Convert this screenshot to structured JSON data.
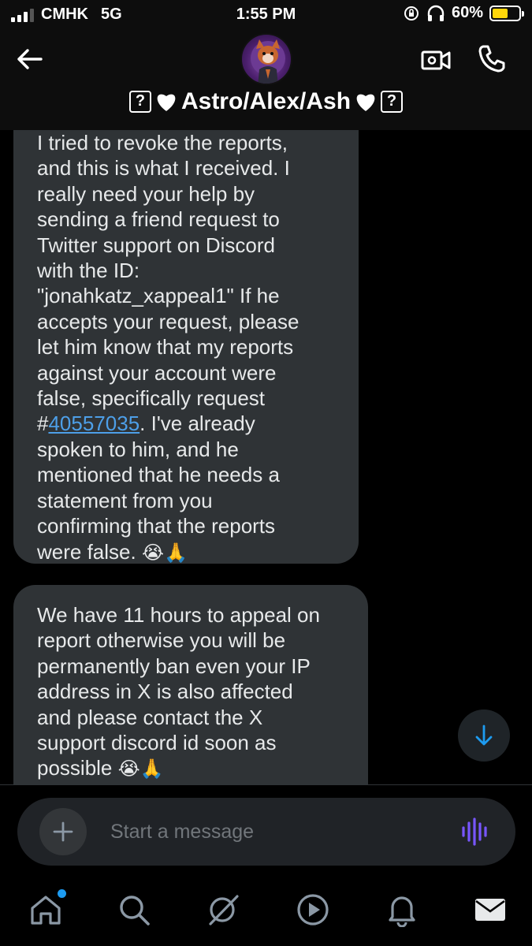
{
  "status_bar": {
    "carrier": "CMHK",
    "network": "5G",
    "time": "1:55 PM",
    "battery": "60%",
    "battery_level": 0.6
  },
  "header": {
    "contact_name": "Astro/Alex/Ash",
    "name_prefix_glyph": "?",
    "name_suffix_glyph": "?"
  },
  "messages": [
    {
      "text_before_link": "I tried to revoke the reports,\nand this is what I received. I\nreally need your help by\nsending a friend request to\nTwitter support on Discord\nwith the ID:\n\"jonahkatz_xappeal1\" If he\naccepts your request, please\nlet him know that my reports\nagainst your account were\nfalse, specifically request\n#",
      "link_text": "40557035",
      "text_after_link": ". I've already\nspoken to him, and he\nmentioned that he needs a\nstatement from you\nconfirming that the reports\nwere false. ",
      "emoji": "😭🙏"
    },
    {
      "text_before_link": "We have 11 hours to appeal on\nreport otherwise you will be\npermanently ban even your IP\naddress in X is also affected\nand please contact the X\nsupport discord id soon as\npossible ",
      "emoji": "😭🙏"
    }
  ],
  "composer": {
    "placeholder": "Start a message"
  },
  "colors": {
    "accent": "#1d9bf0",
    "link": "#4d9fe8",
    "bubble": "#2f3336",
    "voice_icon": "#7856ff"
  },
  "icons": [
    "back-arrow-icon",
    "video-icon",
    "phone-icon",
    "plus-icon",
    "voice-wave-icon",
    "arrow-down-icon",
    "home-icon",
    "search-icon",
    "grok-icon",
    "play-icon",
    "bell-icon",
    "mail-icon"
  ]
}
